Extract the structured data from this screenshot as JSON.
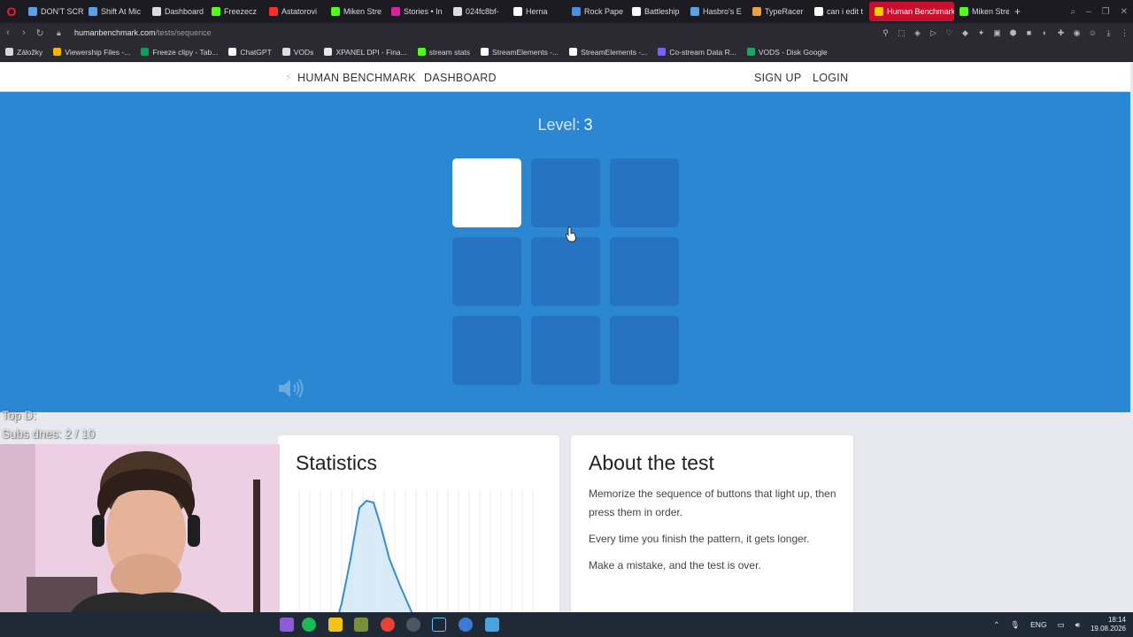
{
  "browser": {
    "tabs": [
      {
        "label": "DON'T SCR",
        "color": "#5aa0e8"
      },
      {
        "label": "Shift At Mic",
        "color": "#5aa0e8"
      },
      {
        "label": "Dashboard",
        "color": "#dddddd"
      },
      {
        "label": "Freezecz",
        "color": "#53fc18"
      },
      {
        "label": "Astatorovi",
        "color": "#ff2a2a"
      },
      {
        "label": "Miken Stre",
        "color": "#53fc18"
      },
      {
        "label": "Stories • In",
        "color": "#d6249f"
      },
      {
        "label": "024fc8bf-",
        "color": "#dddddd"
      },
      {
        "label": "Herna",
        "color": "#ffffff"
      },
      {
        "label": "Rock Pape",
        "color": "#4a90e2"
      },
      {
        "label": "Battleship",
        "color": "#ffffff"
      },
      {
        "label": "Hasbro's E",
        "color": "#5aa0e8"
      },
      {
        "label": "TypeRacer",
        "color": "#e8a33d"
      },
      {
        "label": "can i edit t",
        "color": "#ffffff"
      },
      {
        "label": "Human Benchmark",
        "color": "#ffcc00"
      },
      {
        "label": "Miken Stre",
        "color": "#53fc18"
      }
    ],
    "url_host": "humanbenchmark.com",
    "url_path": "/tests/sequence",
    "bookmarks": [
      {
        "label": "Záložky",
        "color": "#d6d6dc"
      },
      {
        "label": "Viewership Files -...",
        "color": "#f4b400"
      },
      {
        "label": "Freeze clipy - Tab...",
        "color": "#0f9d58"
      },
      {
        "label": "ChatGPT",
        "color": "#ffffff"
      },
      {
        "label": "VODs",
        "color": "#dddddd"
      },
      {
        "label": "XPANEL DPI - Fina...",
        "color": "#e8e8e8"
      },
      {
        "label": "stream stats",
        "color": "#53fc18"
      },
      {
        "label": "StreamElements -...",
        "color": "#ffffff"
      },
      {
        "label": "StreamElements -...",
        "color": "#ffffff"
      },
      {
        "label": "Co-stream Data R...",
        "color": "#7b61ff"
      },
      {
        "label": "VODS - Disk Google",
        "color": "#1fa463"
      }
    ]
  },
  "site": {
    "brand": "HUMAN BENCHMARK",
    "nav_dashboard": "DASHBOARD",
    "nav_signup": "SIGN UP",
    "nav_login": "LOGIN"
  },
  "test": {
    "level_label": "Level:",
    "level_value": "3",
    "squares": [
      true,
      false,
      false,
      false,
      false,
      false,
      false,
      false,
      false
    ],
    "accent": "#2b87d1",
    "square_color": "#2573c1"
  },
  "stats": {
    "title": "Statistics"
  },
  "about": {
    "title": "About the test",
    "paragraphs": [
      "Memorize the sequence of buttons that light up, then press them in order.",
      "Every time you finish the pattern, it gets longer.",
      "Make a mistake, and the test is over."
    ]
  },
  "overlay": {
    "line1": "Top D:",
    "line2": "Subs dnes: 2 / 10"
  },
  "taskbar": {
    "lang": "ENG",
    "time": "18:14",
    "date": "19.08.2026"
  }
}
